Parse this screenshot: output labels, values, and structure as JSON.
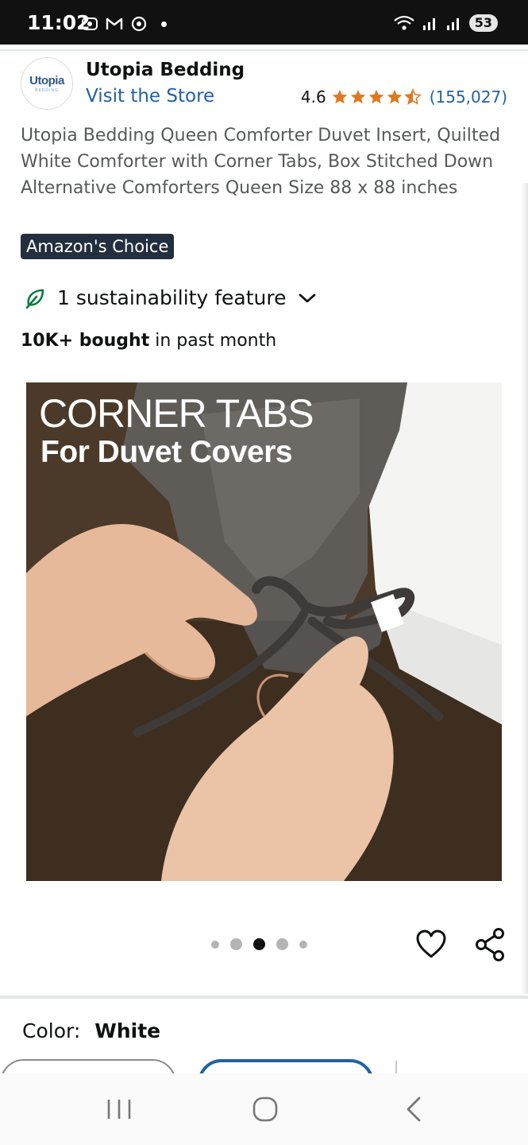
{
  "status_bar": {
    "time": "11:02",
    "battery": "53"
  },
  "store": {
    "name": "Utopia Bedding",
    "logo_text": "Utopia",
    "logo_sub": "BEDDING",
    "visit_label": "Visit the Store"
  },
  "rating": {
    "value": "4.6",
    "count": "(155,027)",
    "stars": 4.6
  },
  "product": {
    "title": "Utopia Bedding Queen Comforter Duvet Insert, Quilted White Comforter with Corner Tabs, Box Stitched Down Alternative Comforters Queen Size 88 x 88 inches"
  },
  "badge": "Amazon's Choice",
  "sustainability": "1 sustainability feature",
  "bought": {
    "bold": "10K+ bought",
    "rest": " in past month"
  },
  "hero": {
    "line1": "CORNER TABS",
    "line2": "For Duvet Covers"
  },
  "carousel": {
    "count": 5,
    "active_index": 2
  },
  "color": {
    "label": "Color:",
    "value": "White"
  },
  "colors": {
    "accent_link": "#2162a1",
    "star": "#de7921",
    "badge_bg": "#232f3e"
  },
  "icons": [
    "leaf-icon",
    "chevron-down-icon",
    "heart-icon",
    "share-icon",
    "recents-icon",
    "home-icon",
    "back-icon"
  ]
}
